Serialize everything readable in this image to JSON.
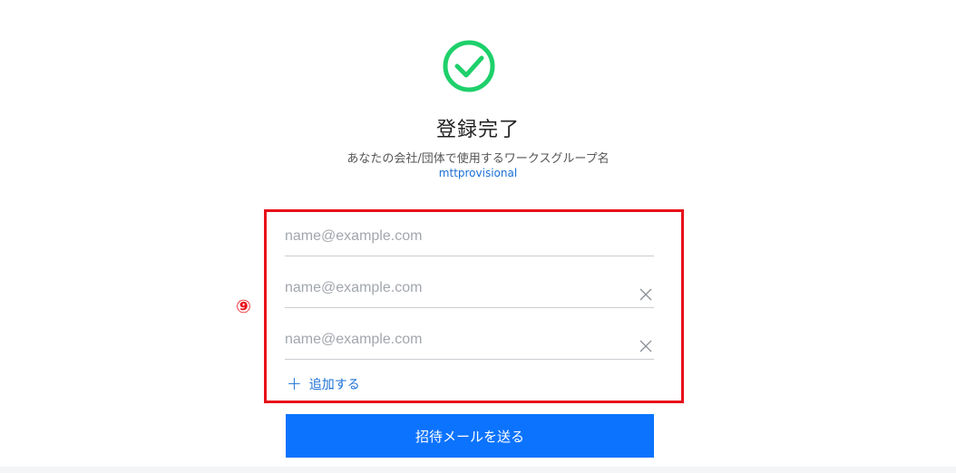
{
  "header": {
    "title": "登録完了",
    "subtitle": "あなたの会社/団体で使用するワークスグループ名",
    "workspace_name": "mttprovisional"
  },
  "annotation": {
    "step_marker": "⑨",
    "color": "#e8101a"
  },
  "invite_form": {
    "emails": [
      {
        "value": "",
        "placeholder": "name@example.com",
        "removable": false
      },
      {
        "value": "",
        "placeholder": "name@example.com",
        "removable": true
      },
      {
        "value": "",
        "placeholder": "name@example.com",
        "removable": true
      }
    ],
    "add_label": "追加する",
    "send_label": "招待メールを送る"
  },
  "colors": {
    "success_green": "#1ed06b",
    "link_blue": "#1a6fd6",
    "primary_button": "#0b73fe"
  },
  "icons": {
    "success": "check-circle-icon",
    "clear": "close-icon",
    "add": "plus-icon"
  }
}
